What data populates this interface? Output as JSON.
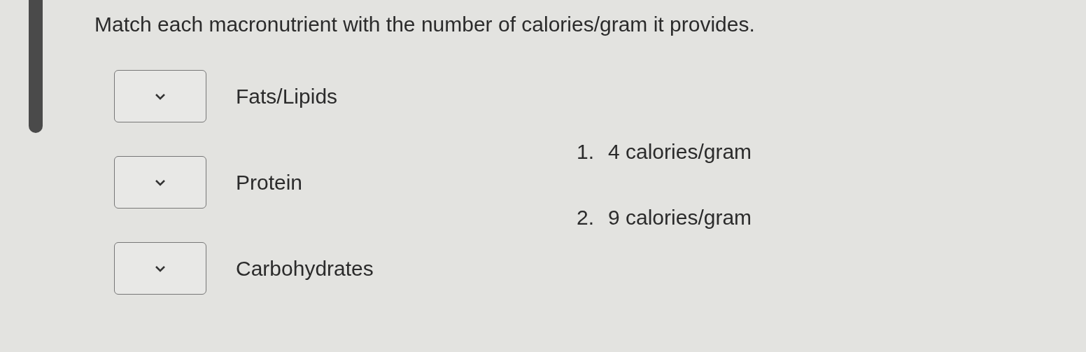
{
  "question": "Match each macronutrient with the number of calories/gram it provides.",
  "items": [
    {
      "label": "Fats/Lipids"
    },
    {
      "label": "Protein"
    },
    {
      "label": "Carbohydrates"
    }
  ],
  "options": [
    {
      "number": "1.",
      "text": "4 calories/gram"
    },
    {
      "number": "2.",
      "text": "9 calories/gram"
    }
  ]
}
